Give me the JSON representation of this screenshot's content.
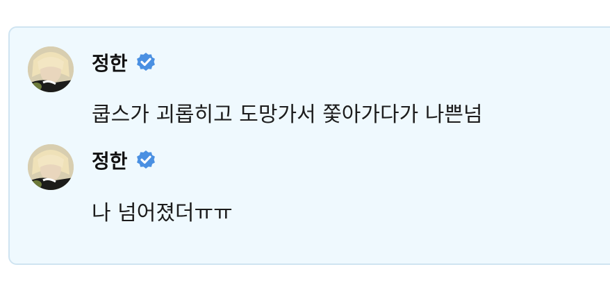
{
  "messages": [
    {
      "author": "정한",
      "verified": true,
      "text": "쿱스가 괴롭히고 도망가서 쫓아가다가 나쁜넘"
    },
    {
      "author": "정한",
      "verified": true,
      "text": "나 넘어졌더ㅠㅠ"
    }
  ],
  "colors": {
    "card_background": "#eff9fe",
    "card_border": "#cfe4f1",
    "verified_badge": "#4a90e2"
  }
}
